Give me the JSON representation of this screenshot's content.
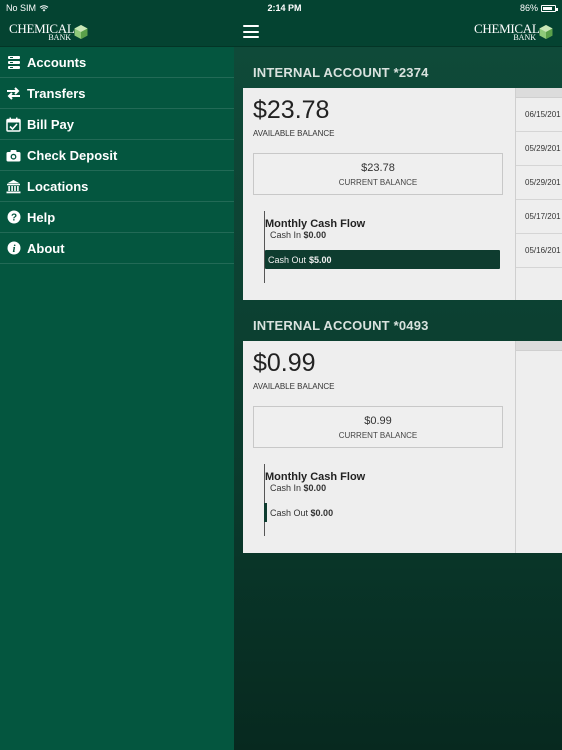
{
  "status_bar": {
    "carrier": "No SIM",
    "time": "2:14 PM",
    "battery_percent": "86%",
    "battery_level": 0.86,
    "icons": [
      "wifi-icon",
      "battery-icon"
    ]
  },
  "nav": {
    "logo_line1": "CHEMICAL",
    "logo_line2": "BANK",
    "menu_icon": "hamburger-icon"
  },
  "colors": {
    "brand_green": "#04563f",
    "header_green": "#044331",
    "logo_accent": "#8fc97a",
    "dark_bar": "#0e3c2f"
  },
  "sidebar": {
    "items": [
      {
        "label": "Accounts",
        "icon": "accounts-icon"
      },
      {
        "label": "Transfers",
        "icon": "transfers-icon"
      },
      {
        "label": "Bill Pay",
        "icon": "calendar-check-icon"
      },
      {
        "label": "Check Deposit",
        "icon": "camera-icon"
      },
      {
        "label": "Locations",
        "icon": "bank-building-icon"
      },
      {
        "label": "Help",
        "icon": "question-icon"
      },
      {
        "label": "About",
        "icon": "info-icon"
      }
    ]
  },
  "accounts": [
    {
      "header": "INTERNAL ACCOUNT *2374",
      "available_balance": "$23.78",
      "available_caption": "AVAILABLE BALANCE",
      "current_balance": "$23.78",
      "current_caption": "CURRENT BALANCE",
      "cashflow_title": "Monthly Cash Flow",
      "cash_in_label": "Cash In",
      "cash_in_value": "$0.00",
      "cash_out_label": "Cash Out",
      "cash_out_value": "$5.00",
      "transaction_dates": [
        "06/15/201",
        "05/29/201",
        "05/29/201",
        "05/17/201",
        "05/16/201"
      ]
    },
    {
      "header": "INTERNAL ACCOUNT *0493",
      "available_balance": "$0.99",
      "available_caption": "AVAILABLE BALANCE",
      "current_balance": "$0.99",
      "current_caption": "CURRENT BALANCE",
      "cashflow_title": "Monthly Cash Flow",
      "cash_in_label": "Cash In",
      "cash_in_value": "$0.00",
      "cash_out_label": "Cash Out",
      "cash_out_value": "$0.00",
      "transaction_dates": []
    }
  ]
}
